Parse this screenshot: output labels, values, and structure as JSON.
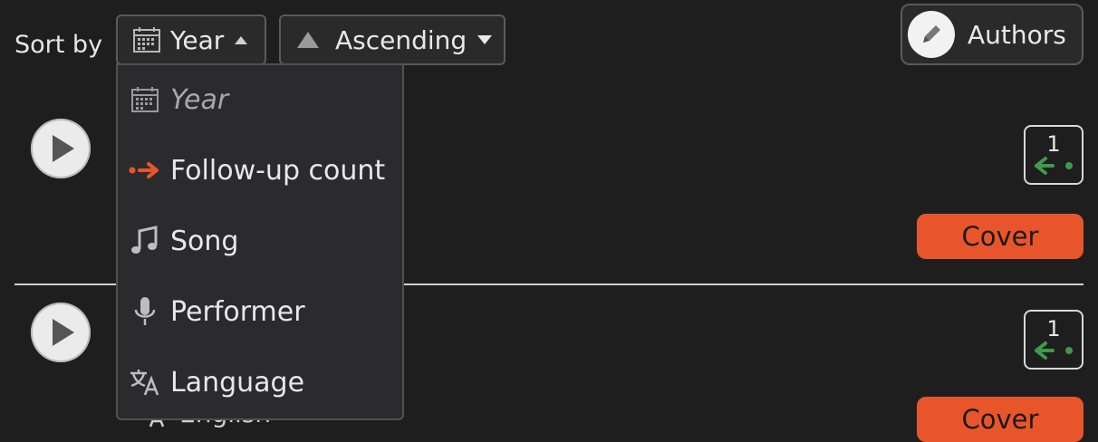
{
  "toolbar": {
    "sort_label": "Sort by",
    "sort_field": {
      "label": "Year",
      "icon": "calendar-icon"
    },
    "sort_order": {
      "label": "Ascending",
      "icon": "triangle-up-icon"
    },
    "authors_button": {
      "label": "Authors",
      "icon": "pencil-icon"
    }
  },
  "dropdown": {
    "items": [
      {
        "label": "Year",
        "icon": "calendar-icon",
        "current": true
      },
      {
        "label": "Follow-up count",
        "icon": "arrow-right-icon",
        "color": "#e9552b"
      },
      {
        "label": "Song",
        "icon": "music-note-icon"
      },
      {
        "label": "Performer",
        "icon": "microphone-icon"
      },
      {
        "label": "Language",
        "icon": "translate-icon"
      }
    ]
  },
  "entries": [
    {
      "followup_count": "1",
      "badge": "Cover",
      "badge_color": "#e9552b"
    },
    {
      "followup_count": "1",
      "badge": "Cover",
      "badge_color": "#e9552b",
      "language": "English"
    }
  ],
  "colors": {
    "accent": "#e9552b",
    "followup_arrow": "#3f9a4a",
    "background": "#1e1e1e"
  }
}
